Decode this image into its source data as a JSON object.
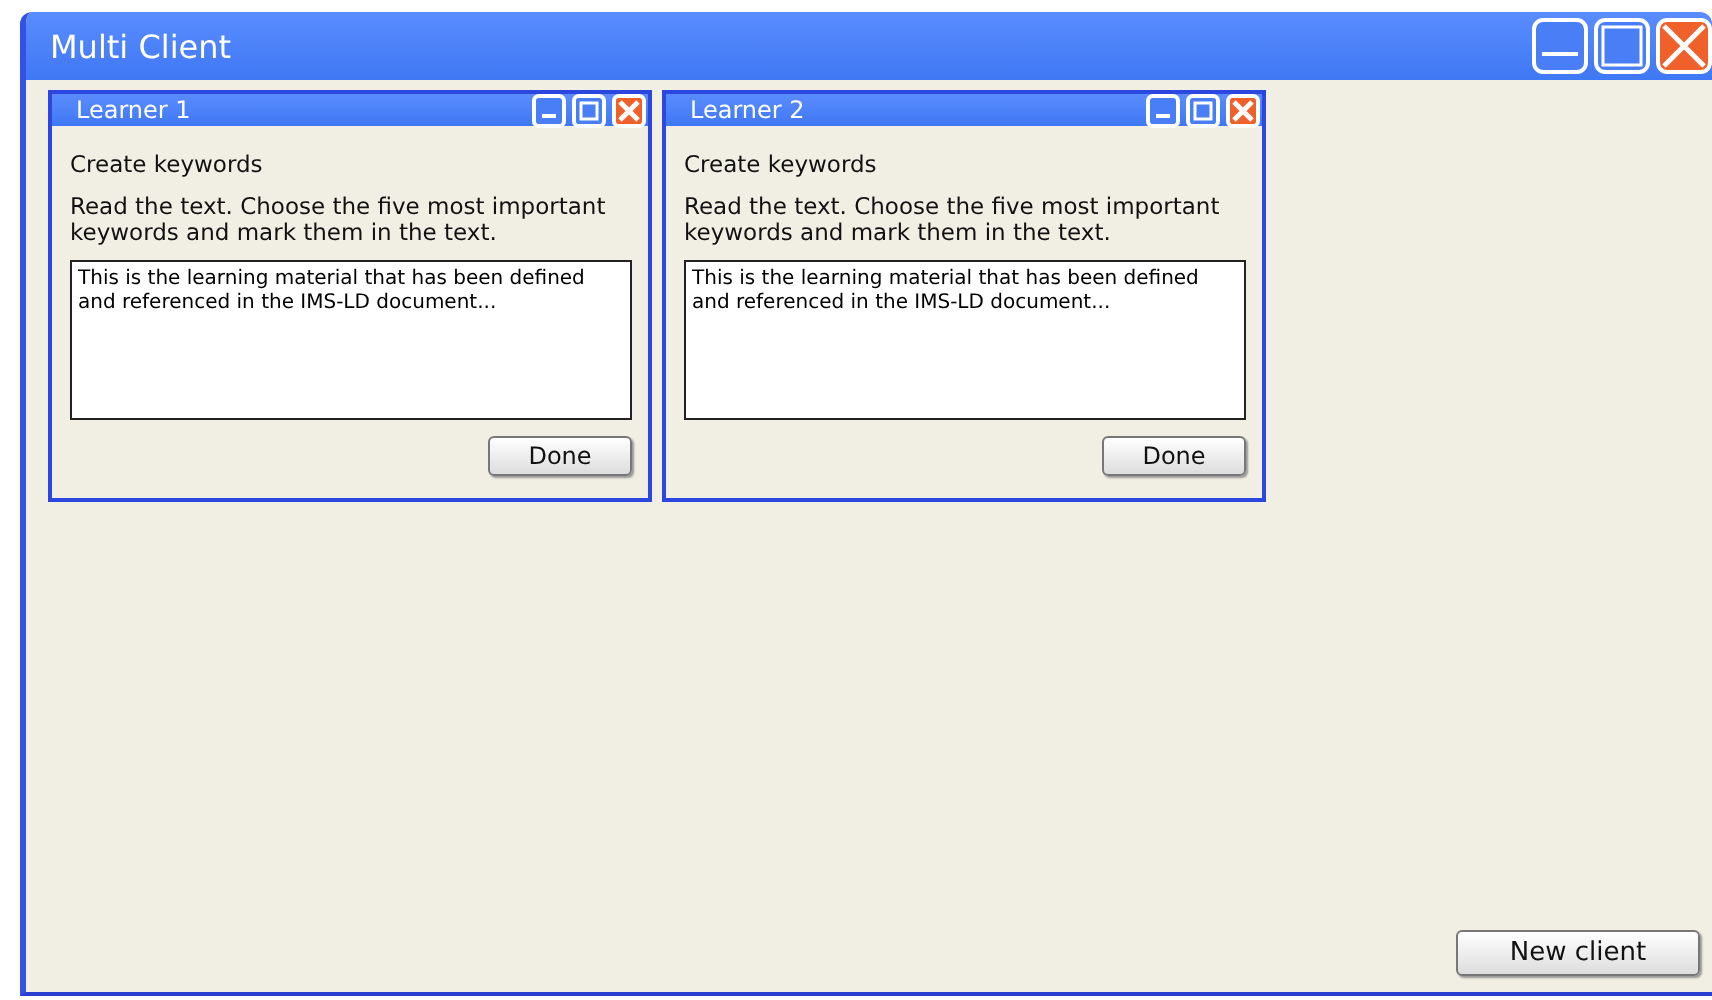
{
  "window": {
    "title": "Multi Client"
  },
  "learners": [
    {
      "title": "Learner 1",
      "heading": "Create keywords",
      "instructions": "Read the text. Choose the five most important keywords and mark them in the text.",
      "material": "This is the learning material that has been defined and referenced in the IMS-LD document...",
      "button": "Done"
    },
    {
      "title": "Learner 2",
      "heading": "Create keywords",
      "instructions": "Read the text. Choose the five most important keywords and mark them in the text.",
      "material": "This is the learning material that has been defined and referenced in the IMS-LD document...",
      "button": "Done"
    }
  ],
  "new_client_button": "New client"
}
